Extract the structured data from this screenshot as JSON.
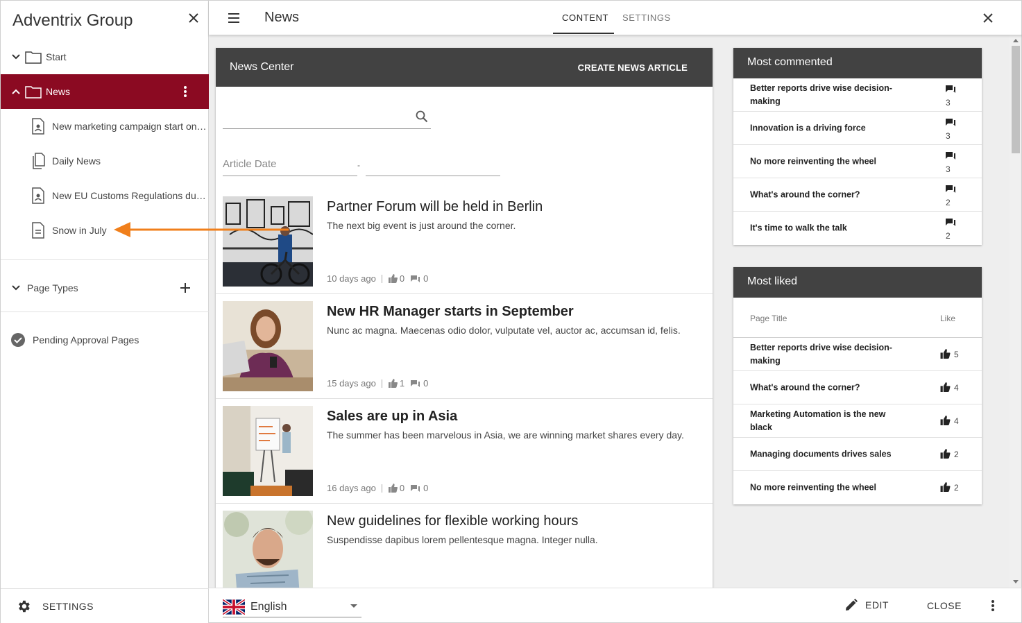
{
  "sidebar": {
    "title": "Adventrix Group",
    "tree": [
      {
        "label": "Start"
      },
      {
        "label": "News"
      }
    ],
    "pages": [
      {
        "label": "New marketing campaign start on …"
      },
      {
        "label": "Daily News"
      },
      {
        "label": "New EU Customs Regulations due …"
      },
      {
        "label": "Snow in July"
      }
    ],
    "page_types_label": "Page Types",
    "pending_label": "Pending Approval Pages",
    "settings_label": "SETTINGS"
  },
  "topbar": {
    "title": "News",
    "tabs": [
      {
        "label": "CONTENT",
        "active": true
      },
      {
        "label": "SETTINGS",
        "active": false
      }
    ]
  },
  "news_center": {
    "title": "News Center",
    "create_label": "CREATE NEWS ARTICLE",
    "date_label": "Article Date",
    "date_separator": "-",
    "articles": [
      {
        "title": "Partner Forum will be held in Berlin",
        "desc": "The next big event is just around the corner.",
        "age": "10 days ago",
        "likes": "0",
        "comments": "0"
      },
      {
        "title": "New HR Manager starts in September",
        "desc": "Nunc ac magna. Maecenas odio dolor, vulputate vel, auctor ac, accumsan id, felis.",
        "age": "15 days ago",
        "likes": "1",
        "comments": "0"
      },
      {
        "title": "Sales are up in Asia",
        "desc": "The summer has been marvelous in Asia, we are winning market shares every day.",
        "age": "16 days ago",
        "likes": "0",
        "comments": "0"
      },
      {
        "title": "New guidelines for flexible working hours",
        "desc": "Suspendisse dapibus lorem pellentesque magna. Integer nulla.",
        "age": "",
        "likes": "",
        "comments": ""
      }
    ]
  },
  "most_commented": {
    "title": "Most commented",
    "rows": [
      {
        "title": "Better reports drive wise decision-making",
        "count": "3"
      },
      {
        "title": "Innovation is a driving force",
        "count": "3"
      },
      {
        "title": "No more reinventing the wheel",
        "count": "3"
      },
      {
        "title": "What's around the corner?",
        "count": "2"
      },
      {
        "title": "It's time to walk the talk",
        "count": "2"
      }
    ]
  },
  "most_liked": {
    "title": "Most liked",
    "col_title": "Page Title",
    "col_like": "Like",
    "rows": [
      {
        "title": "Better reports drive wise decision-making",
        "count": "5"
      },
      {
        "title": "What's around the corner?",
        "count": "4"
      },
      {
        "title": "Marketing Automation is the new black",
        "count": "4"
      },
      {
        "title": "Managing documents drives sales",
        "count": "2"
      },
      {
        "title": "No more reinventing the wheel",
        "count": "2"
      }
    ]
  },
  "bottombar": {
    "language": "English",
    "edit_label": "EDIT",
    "close_label": "CLOSE"
  },
  "colors": {
    "accent": "#8b0a22",
    "panel_header": "#424242",
    "arrow": "#f07f1b"
  }
}
